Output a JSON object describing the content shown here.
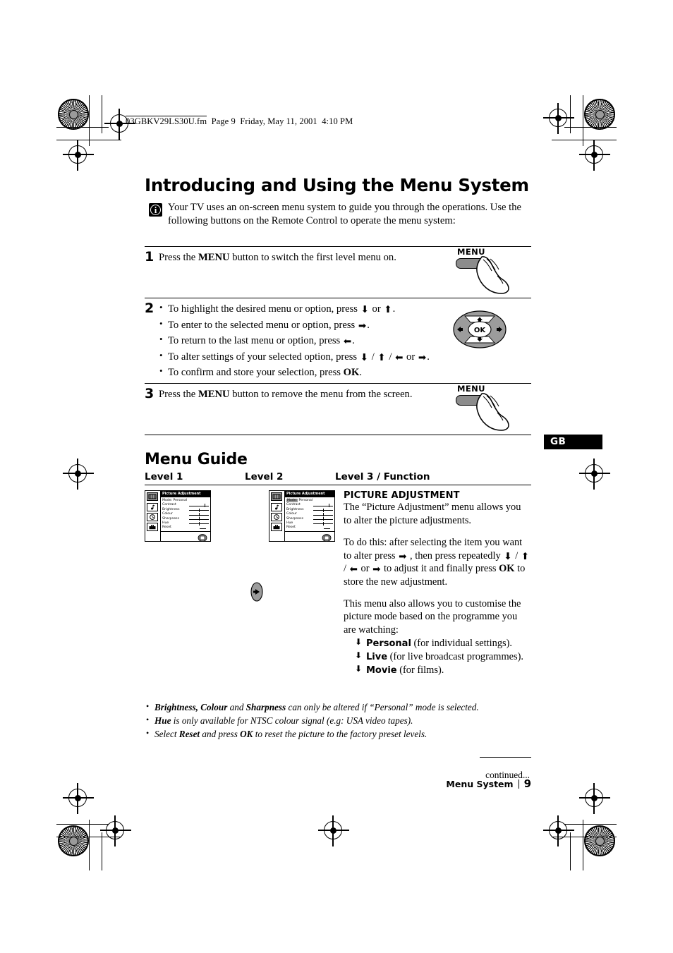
{
  "file_header": {
    "filename": "03GBKV29LS30U.fm",
    "page": "Page 9",
    "day": "Friday, May 11, 2001",
    "time": "4:10 PM"
  },
  "title": "Introducing and Using the Menu System",
  "intro": {
    "icon": "info-icon",
    "text": "Your TV uses an on-screen menu system to guide you through the operations. Use the following buttons on the Remote Control to operate the menu system:"
  },
  "steps": [
    {
      "num": "1",
      "text_before": "Press the ",
      "bold": "MENU",
      "text_after": " button to switch the first level menu on.",
      "art_label": "MENU"
    },
    {
      "num": "2",
      "bullets": [
        {
          "pre": "To highlight the desired menu or option, press ",
          "arrows": [
            "down"
          ],
          "mid": " or ",
          "arrows2": [
            "up"
          ],
          "post": "."
        },
        {
          "pre": "To enter to the selected menu or option, press ",
          "arrows": [
            "right"
          ],
          "post": "."
        },
        {
          "pre": "To return to the last menu or option, press ",
          "arrows": [
            "left"
          ],
          "post": "."
        },
        {
          "pre": "To alter settings of your selected option, press ",
          "arrows": [
            "down",
            "up",
            "left"
          ],
          "mid": " or ",
          "arrows2": [
            "right"
          ],
          "post": "."
        },
        {
          "pre": "To confirm and store your selection, press ",
          "bold": "OK",
          "post": "."
        }
      ],
      "art_label": "OK"
    },
    {
      "num": "3",
      "text_before": "Press the ",
      "bold": "MENU",
      "text_after": " button to remove the menu from the screen.",
      "art_label": "MENU"
    }
  ],
  "menu_guide": {
    "heading": "Menu Guide",
    "columns": {
      "level1": "Level 1",
      "level2": "Level 2",
      "level3": "Level 3 / Function"
    },
    "osd": {
      "title": "Picture Adjustment",
      "icons": [
        "picture-icon",
        "audio-icon",
        "timer-icon",
        "setup-icon"
      ],
      "mode_key": "Mode:",
      "mode_value": "Personal",
      "rows": [
        "Contrast",
        "Brightness",
        "Colour",
        "Sharpness",
        "Hue",
        "Reset"
      ]
    },
    "arrow_between": "right",
    "function": {
      "head": "PICTURE ADJUSTMENT",
      "p1": "The “Picture Adjustment”  menu allows you to alter the picture adjustments.",
      "p2_a": "To do this: after selecting the item you want to alter press ",
      "p2_b": " , then press repeatedly ",
      "p2_c": " to adjust it and finally press ",
      "p2_ok": "OK",
      "p2_d": " to store the new adjustment.",
      "p3": "This menu also allows you to customise the picture mode based on the programme you are watching:",
      "modes": [
        {
          "name": "Personal",
          "desc": " (for individual settings)."
        },
        {
          "name": "Live",
          "desc": " (for live broadcast programmes)."
        },
        {
          "name": "Movie",
          "desc": " (for films)."
        }
      ]
    }
  },
  "notes": [
    {
      "b1": "Brightness, Colour",
      "t1": " and ",
      "b2": "Sharpness",
      "t2": " can only be altered if “Personal”  mode is selected."
    },
    {
      "b1": "Hue",
      "t2": " is only available for NTSC colour signal (e.g: USA video tapes)."
    },
    {
      "t0": "Select ",
      "b1": "Reset",
      "t1": " and press ",
      "b2": "OK",
      "t2": " to reset the picture to the factory preset levels."
    }
  ],
  "continued": "continued...",
  "footer": {
    "section": "Menu System",
    "page_number": "9"
  },
  "side_tab": "GB"
}
